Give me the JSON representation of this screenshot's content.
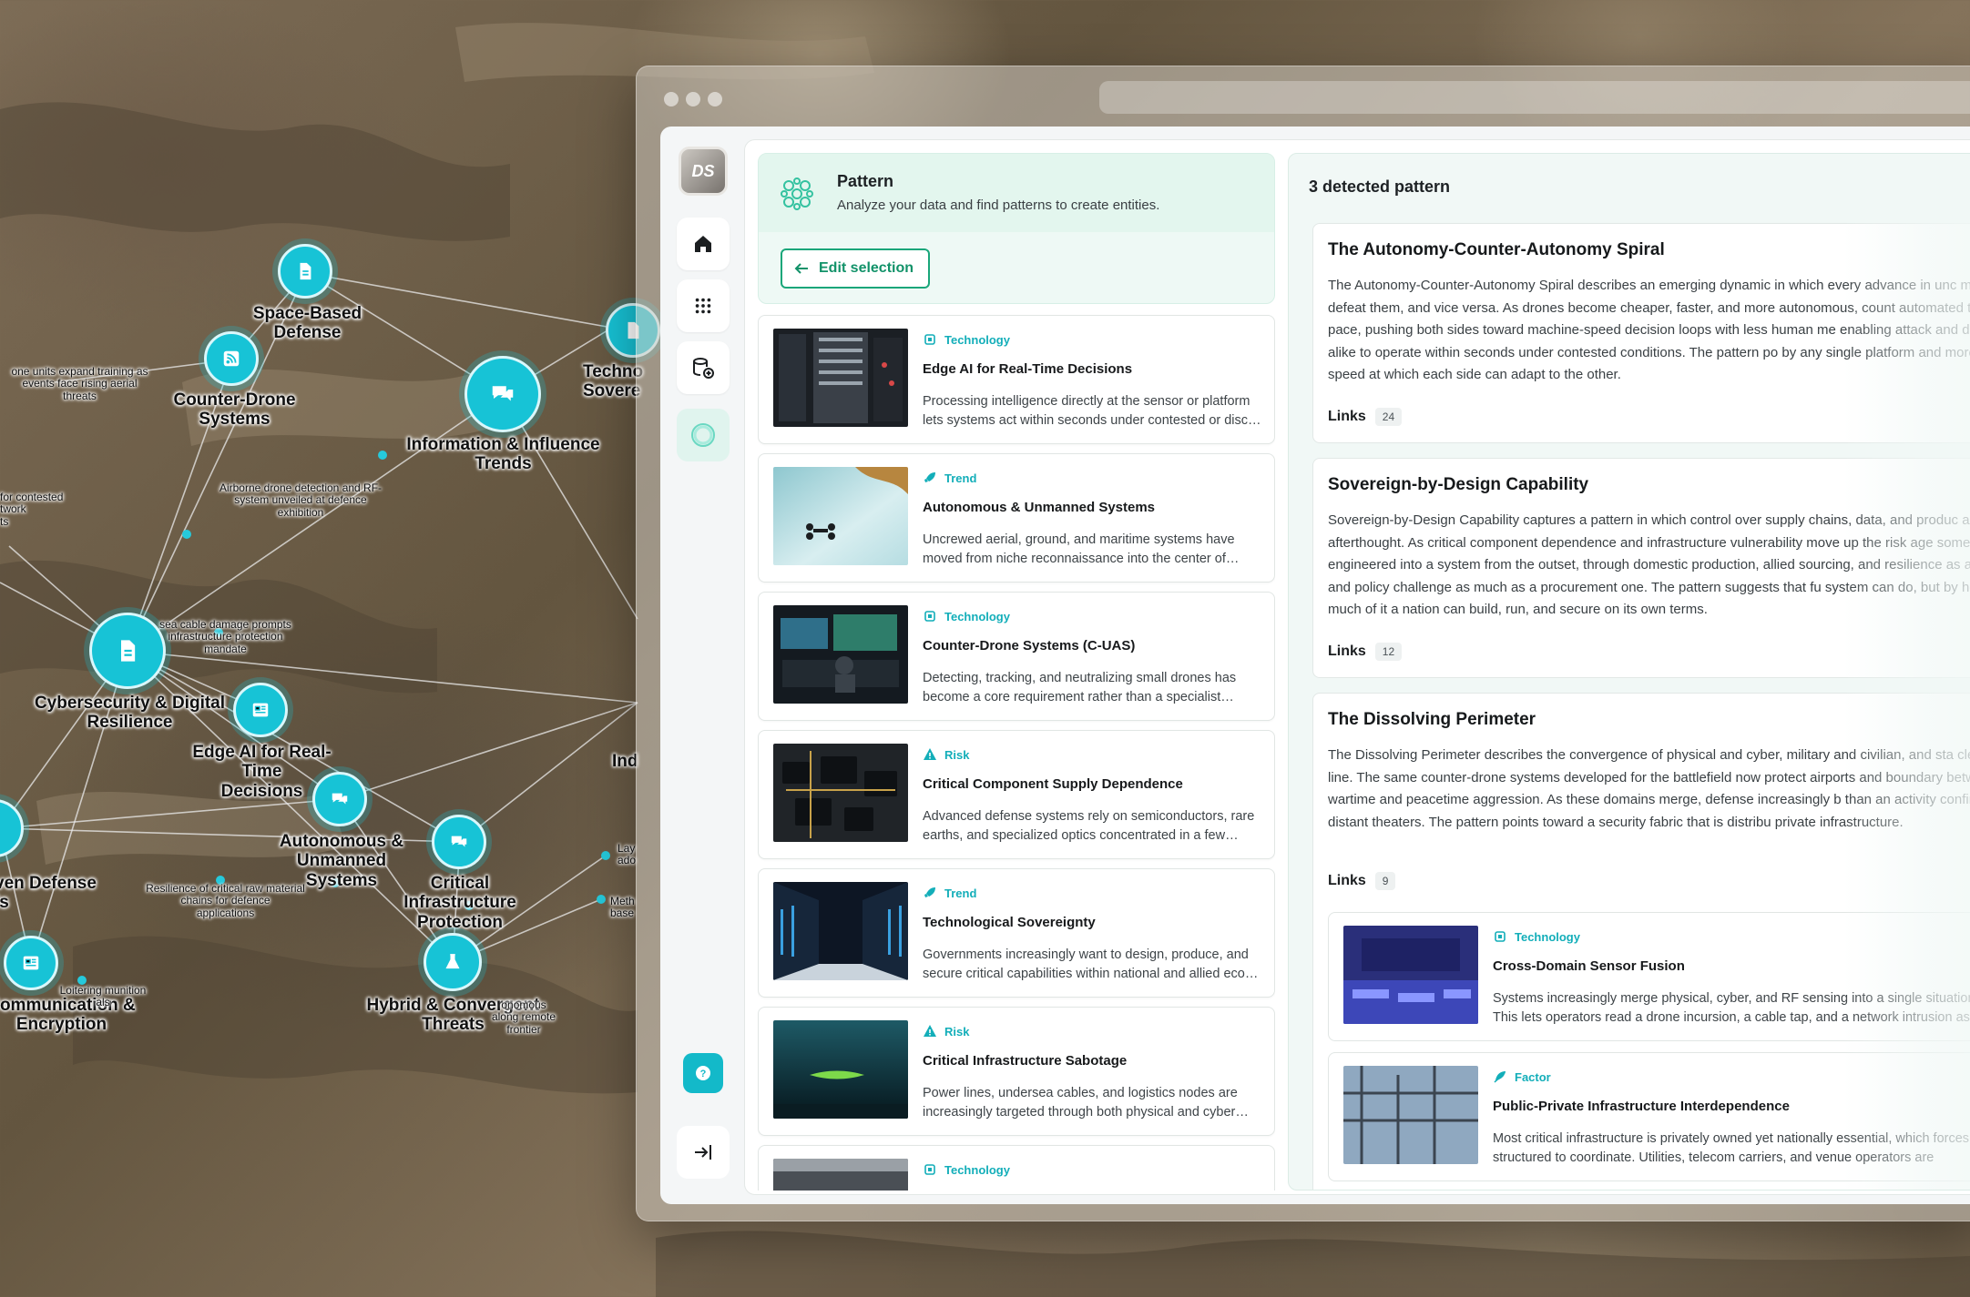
{
  "graph": {
    "nodes": [
      {
        "label": "Space-Based\nDefense",
        "icon": "document-icon"
      },
      {
        "label": "Counter-Drone\nSystems",
        "icon": "rss-icon"
      },
      {
        "label": "Information & Influence\nTrends",
        "icon": "chat-icon"
      },
      {
        "label": "Cybersecurity & Digital\nResilience",
        "icon": "document-icon"
      },
      {
        "label": "Edge AI for Real-Time\nDecisions",
        "icon": "news-icon"
      },
      {
        "label": "Autonomous & Unmanned\nSystems",
        "icon": "chat-icon"
      },
      {
        "label": "Critical Infrastructure\nProtection",
        "icon": "chat-icon"
      },
      {
        "label": "Hybrid & Convergent\nThreats",
        "icon": "flask-icon"
      },
      {
        "label": "Communication &\nEncryption",
        "icon": "news-icon"
      },
      {
        "label": "ven Defense\nls",
        "icon": ""
      },
      {
        "label": "Techno\nSovere",
        "icon": "document-icon"
      },
      {
        "label": "Ind",
        "icon": ""
      }
    ],
    "small_labels": [
      "one units expand training as\nevents face rising aerial\nthreats",
      "Airborne drone detection and RF-\nsystem unveiled at defence\nexhibition",
      "for contested\ntwork\nts",
      "sea cable damage prompts\ninfrastructure protection\nmandate",
      "Resilience of critical raw material\nchains for defence\napplications",
      "Loitering munition\nals",
      "onomous\nalong remote\nfrontier",
      "Lay\nado",
      "Meth\nbase"
    ]
  },
  "sidebar": {
    "logo_text": "DS",
    "items": [
      {
        "name": "home",
        "icon": "home-icon"
      },
      {
        "name": "apps",
        "icon": "grid-icon"
      },
      {
        "name": "add-entity",
        "icon": "database-add-icon"
      },
      {
        "name": "pattern",
        "icon": "ring-icon"
      }
    ],
    "help_icon": "help-icon",
    "collapse_icon": "collapse-right-icon"
  },
  "pattern_panel": {
    "title": "Pattern",
    "subtitle": "Analyze your data and find patterns to create entities.",
    "edit_button": "Edit selection",
    "cards": [
      {
        "tag": "Technology",
        "tag_icon": "chip-icon",
        "title": "Edge AI for Real-Time Decisions",
        "desc": "Processing intelligence directly at the sensor or platform lets systems act within seconds under contested or disc…"
      },
      {
        "tag": "Trend",
        "tag_icon": "rocket-icon",
        "title": "Autonomous & Unmanned Systems",
        "desc": "Uncrewed aerial, ground, and maritime systems have moved from niche reconnaissance into the center of ope…"
      },
      {
        "tag": "Technology",
        "tag_icon": "chip-icon",
        "title": "Counter-Drone Systems (C-UAS)",
        "desc": "Detecting, tracking, and neutralizing small drones has become a core requirement rather than a specialist nich…"
      },
      {
        "tag": "Risk",
        "tag_icon": "warning-icon",
        "title": "Critical Component Supply Dependence",
        "desc": "Advanced defense systems rely on semiconductors, rare earths, and specialized optics concentrated in a few sup…"
      },
      {
        "tag": "Trend",
        "tag_icon": "rocket-icon",
        "title": "Technological Sovereignty",
        "desc": "Governments increasingly want to design, produce, and secure critical capabilities within national and allied eco…"
      },
      {
        "tag": "Risk",
        "tag_icon": "warning-icon",
        "title": "Critical Infrastructure Sabotage",
        "desc": "Power lines, undersea cables, and logistics nodes are increasingly targeted through both physical and cyber m…"
      },
      {
        "tag": "Technology",
        "tag_icon": "chip-icon",
        "title": "",
        "desc": ""
      }
    ]
  },
  "detected": {
    "title": "3 detected pattern",
    "links_label": "Links",
    "patterns": [
      {
        "title": "The Autonomy-Counter-Autonomy Spiral",
        "body": "The Autonomy-Counter-Autonomy Spiral describes an emerging dynamic in which every advance in unc means to defeat them, and vice versa. As drones become cheaper, faster, and more autonomous, count automated to keep pace, pushing both sides toward machine-speed decision loops with less human me enabling attack and defense alike to operate within seconds under contested conditions. The pattern po by any single platform and more by the speed at which each side can adapt to the other.",
        "links": "24"
      },
      {
        "title": "Sovereign-by-Design Capability",
        "body": "Sovereign-by-Design Capability captures a pattern in which control over supply chains, data, and produc an afterthought. As critical component dependence and infrastructure vulnerability move up the risk age something engineered into a system from the outset, through domestic production, allied sourcing, and resilience as a design and policy challenge as much as a procurement one. The pattern suggests that fu system can do, but by how much of it a nation can build, run, and secure on its own terms.",
        "links": "12"
      },
      {
        "title": "The Dissolving Perimeter",
        "body": "The Dissolving Perimeter describes the convergence of physical and cyber, military and civilian, and sta clear front line. The same counter-drone systems developed for the battlefield now protect airports and boundary between wartime and peacetime aggression. As these domains merge, defense increasingly b than an activity confined to distant theaters. The pattern points toward a security fabric that is distribu private infrastructure.",
        "links": "9",
        "sub_cards": [
          {
            "tag": "Technology",
            "tag_icon": "chip-icon",
            "title": "Cross-Domain Sensor Fusion",
            "desc": "Systems increasingly merge physical, cyber, and RF sensing into a single situational This lets operators read a drone incursion, a cable tap, and a network intrusion as"
          },
          {
            "tag": "Factor",
            "tag_icon": "feather-icon",
            "title": "Public-Private Infrastructure Interdependence",
            "desc": "Most critical infrastructure is privately owned yet nationally essential, which forces never structured to coordinate. Utilities, telecom carriers, and venue operators are"
          }
        ]
      }
    ]
  },
  "colors": {
    "accent_teal": "#13aeb9",
    "accent_green": "#1aa67a",
    "node_cyan": "#17c3d6"
  }
}
